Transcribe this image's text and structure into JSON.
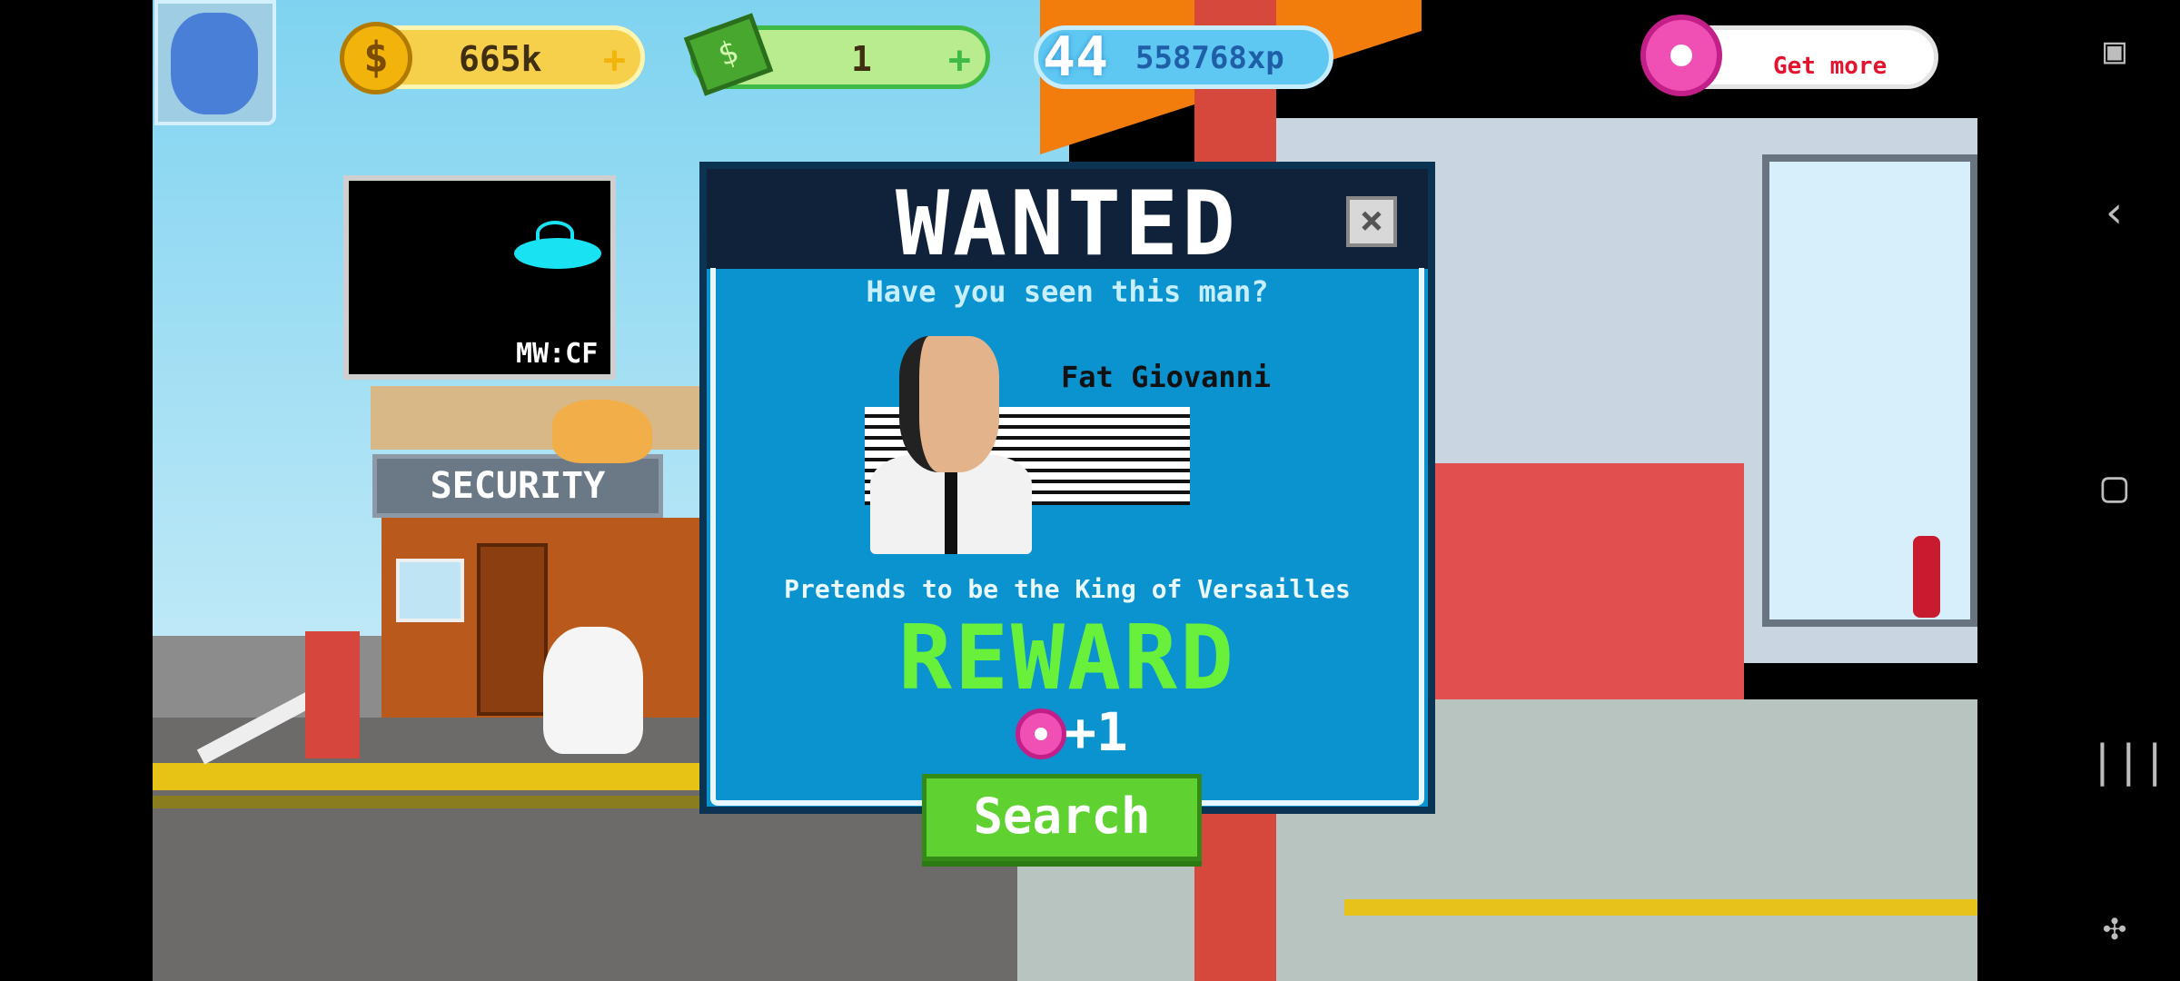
{
  "hud": {
    "coins": "665k",
    "cash": "1",
    "level": "44",
    "xp": "558768xp",
    "get_more": "Get more",
    "plus": "+"
  },
  "scene": {
    "billboard_text": "MW:CF",
    "security_sign": "SECURITY"
  },
  "dialog": {
    "title": "WANTED",
    "close": "×",
    "question": "Have you seen this man?",
    "name": "Fat Giovanni",
    "description": "Pretends to be the King of Versailles",
    "reward_title": "REWARD",
    "reward_amount": "+1",
    "search_button": "Search"
  },
  "icons": {
    "coin": "coin-icon",
    "cash": "cash-icon",
    "level": "level-badge-icon",
    "donut": "donut-icon",
    "screenshot": "screenshot-icon",
    "back": "back-icon",
    "home": "home-icon",
    "recents": "recents-icon",
    "gamepad": "gamepad-icon"
  },
  "colors": {
    "dialog_bg": "#0a93cf",
    "header_bg": "#10213a",
    "reward_green": "#69f03a",
    "search_green": "#5fd231",
    "get_more_red": "#e2142f"
  }
}
